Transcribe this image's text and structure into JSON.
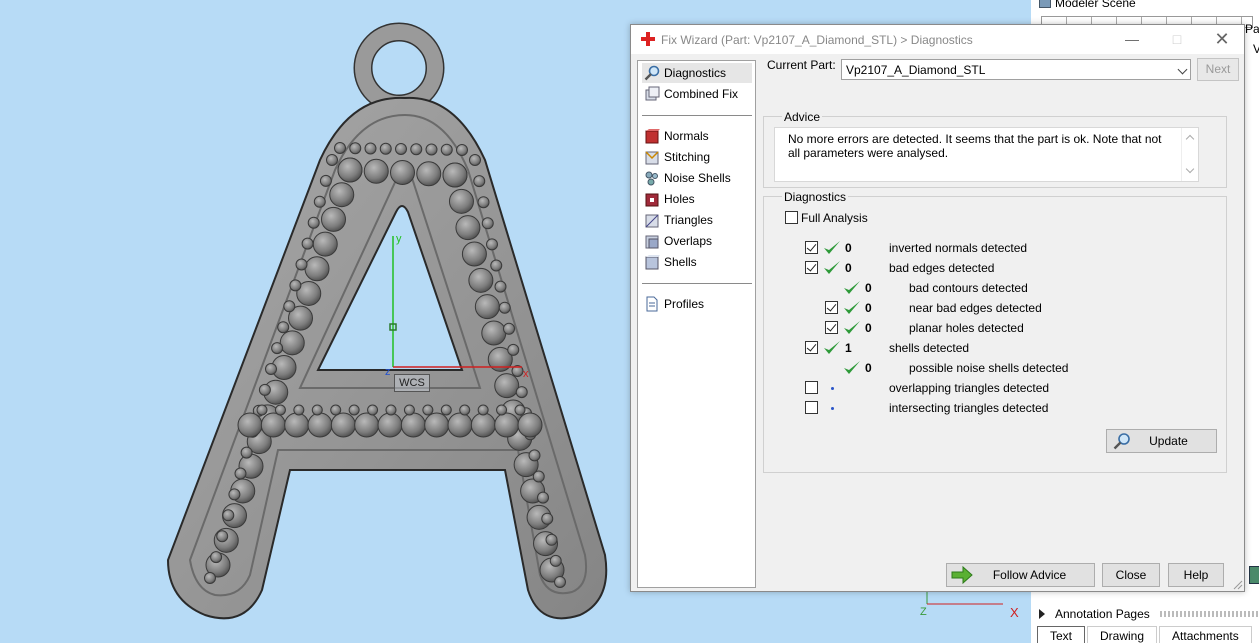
{
  "viewport": {
    "wcs_label": "WCS",
    "axis_y": "y",
    "axis_x": "x",
    "axis_z": "z",
    "corner_axis_z": "Z",
    "corner_axis_x": "X"
  },
  "right_panel": {
    "scene_title": "Modeler Scene",
    "fragment_a": "Par",
    "fragment_b": "V",
    "annotation_pages": "Annotation Pages",
    "tabs": [
      "Text",
      "Drawing",
      "Attachments"
    ]
  },
  "dialog": {
    "title": "Fix Wizard (Part: Vp2107_A_Diamond_STL) > Diagnostics",
    "nav": {
      "group1": [
        {
          "label": "Diagnostics",
          "icon": "magnifier-icon"
        },
        {
          "label": "Combined Fix",
          "icon": "cube-stack-icon"
        }
      ],
      "group2": [
        {
          "label": "Normals",
          "icon": "normals-cube-icon"
        },
        {
          "label": "Stitching",
          "icon": "stitching-icon"
        },
        {
          "label": "Noise Shells",
          "icon": "noise-shells-icon"
        },
        {
          "label": "Holes",
          "icon": "holes-icon"
        },
        {
          "label": "Triangles",
          "icon": "triangles-icon"
        },
        {
          "label": "Overlaps",
          "icon": "overlaps-icon"
        },
        {
          "label": "Shells",
          "icon": "shells-icon"
        }
      ],
      "group3": [
        {
          "label": "Profiles",
          "icon": "document-icon"
        }
      ]
    },
    "current_part_label": "Current Part:",
    "current_part_value": "Vp2107_A_Diamond_STL",
    "next_label": "Next",
    "advice": {
      "title": "Advice",
      "text": "No more errors are detected. It seems that the part is ok. Note that not all parameters were analysed."
    },
    "diagnostics": {
      "title": "Diagnostics",
      "full_analysis_label": "Full Analysis",
      "full_analysis_checked": false,
      "rows": [
        {
          "checked": true,
          "status": "ok",
          "count": "0",
          "label": "inverted normals detected"
        },
        {
          "checked": true,
          "status": "ok",
          "count": "0",
          "label": "bad edges detected"
        },
        {
          "checkbox": false,
          "status": "ok",
          "count": "0",
          "label": "bad contours detected"
        },
        {
          "checked": true,
          "status": "ok",
          "count": "0",
          "label": "near bad edges detected"
        },
        {
          "checked": true,
          "status": "ok",
          "count": "0",
          "label": "planar holes detected"
        },
        {
          "checked": true,
          "status": "ok",
          "count": "1",
          "label": "shells detected"
        },
        {
          "checkbox": false,
          "status": "ok",
          "count": "0",
          "label": "possible noise shells detected"
        },
        {
          "checked": false,
          "status": "none",
          "count": "",
          "label": "overlapping triangles detected"
        },
        {
          "checked": false,
          "status": "none",
          "count": "",
          "label": "intersecting triangles detected"
        }
      ]
    },
    "update_label": "Update",
    "follow_advice_label": "Follow Advice",
    "close_label": "Close",
    "help_label": "Help"
  }
}
